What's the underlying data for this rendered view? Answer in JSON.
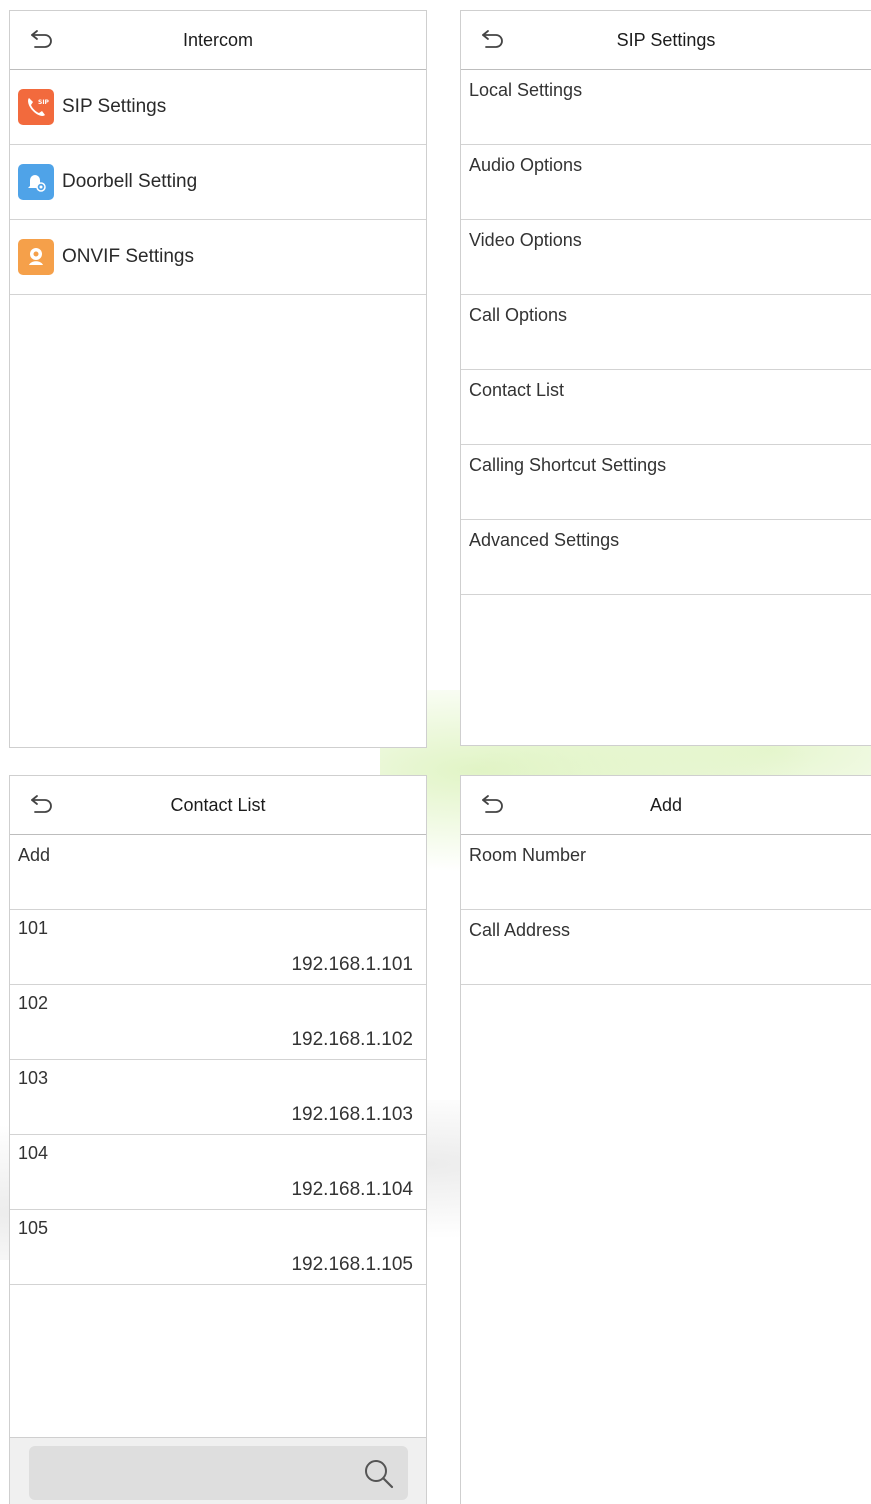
{
  "intercom": {
    "title": "Intercom",
    "items": [
      {
        "label": "SIP Settings",
        "icon": "sip-phone-icon",
        "color": "#f26a3d"
      },
      {
        "label": "Doorbell Setting",
        "icon": "doorbell-icon",
        "color": "#4fa3e8"
      },
      {
        "label": "ONVIF Settings",
        "icon": "onvif-camera-icon",
        "color": "#f5a04a"
      }
    ]
  },
  "sip": {
    "title": "SIP Settings",
    "items": [
      {
        "label": "Local Settings"
      },
      {
        "label": "Audio Options"
      },
      {
        "label": "Video Options"
      },
      {
        "label": "Call Options"
      },
      {
        "label": "Contact List"
      },
      {
        "label": "Calling Shortcut Settings"
      },
      {
        "label": "Advanced Settings"
      }
    ]
  },
  "contacts": {
    "title": "Contact List",
    "add_label": "Add",
    "rows": [
      {
        "room": "101",
        "address": "192.168.1.101"
      },
      {
        "room": "102",
        "address": "192.168.1.102"
      },
      {
        "room": "103",
        "address": "192.168.1.103"
      },
      {
        "room": "104",
        "address": "192.168.1.104"
      },
      {
        "room": "105",
        "address": "192.168.1.105"
      }
    ]
  },
  "add": {
    "title": "Add",
    "fields": [
      {
        "label": "Room Number"
      },
      {
        "label": "Call Address"
      }
    ]
  }
}
